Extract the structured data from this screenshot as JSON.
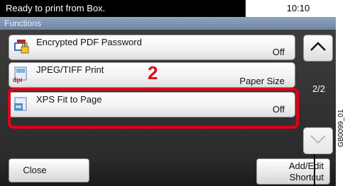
{
  "status": {
    "message": "Ready to print from Box.",
    "time": "10:10"
  },
  "title": "Functions",
  "items": [
    {
      "label": "Encrypted PDF Password",
      "value": "Off",
      "icon": "pdf-lock-icon",
      "icon_tag": ""
    },
    {
      "label": "JPEG/TIFF Print",
      "value": "Paper Size",
      "icon": "dpi-icon",
      "icon_tag": "dpi"
    },
    {
      "label": "XPS Fit to Page",
      "value": "Off",
      "icon": "xps-icon",
      "icon_tag": ""
    }
  ],
  "pagination": {
    "current": "2/2"
  },
  "buttons": {
    "close": "Close",
    "add_edit_line1": "Add/Edit",
    "add_edit_line2": "Shortcut"
  },
  "annotation": {
    "number": "2"
  },
  "caption": "GB0099_01",
  "colors": {
    "highlight": "#e2001a",
    "status_bg": "#000000",
    "title_bg": "#7a90ab"
  }
}
